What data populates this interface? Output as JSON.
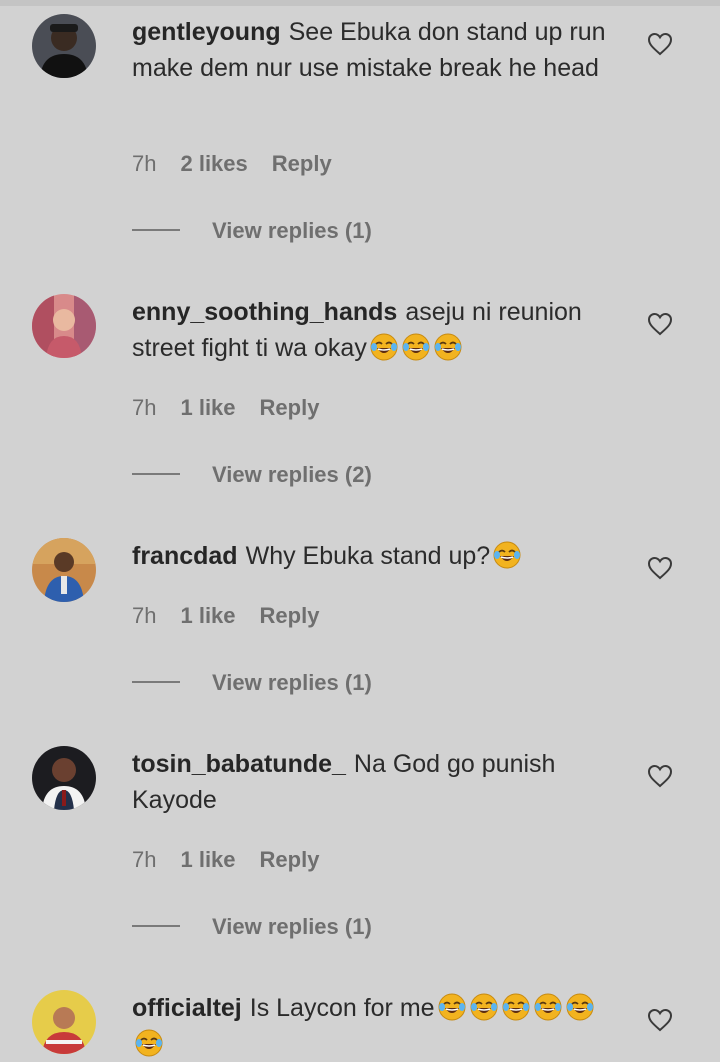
{
  "comments": [
    {
      "username": "gentleyoung",
      "text": "See Ebuka don stand up run make dem nur use mistake break he head",
      "emoji_count": 0,
      "time": "7h",
      "likes": "2 likes",
      "reply": "Reply",
      "view_replies": "View replies (1)",
      "avatar_color": "#2a2d33"
    },
    {
      "username": "enny_soothing_hands",
      "text": "aseju ni reunion street fight ti wa okay",
      "emoji_count": 3,
      "time": "7h",
      "likes": "1 like",
      "reply": "Reply",
      "view_replies": "View replies (2)",
      "avatar_color": "#c96a6f"
    },
    {
      "username": "francdad",
      "text": "Why Ebuka stand up?",
      "emoji_count": 1,
      "time": "7h",
      "likes": "1 like",
      "reply": "Reply",
      "view_replies": "View replies (1)",
      "avatar_color": "#3b6aa8"
    },
    {
      "username": "tosin_babatunde_",
      "text": "Na God go punish Kayode",
      "emoji_count": 0,
      "time": "7h",
      "likes": "1 like",
      "reply": "Reply",
      "view_replies": "View replies (1)",
      "avatar_color": "#1e1e22"
    },
    {
      "username": "officialtej",
      "text": "Is Laycon for me",
      "emoji_count": 6,
      "time": "",
      "likes": "",
      "reply": "",
      "view_replies": "",
      "avatar_color": "#e2c640"
    }
  ],
  "icons": {
    "like": "heart-outline-icon",
    "emoji": "face-with-tears-of-joy-emoji"
  },
  "colors": {
    "background": "#d2d2d2",
    "username": "#262626",
    "meta": "#6f6f6f",
    "emoji_face": "#f2b31f"
  }
}
